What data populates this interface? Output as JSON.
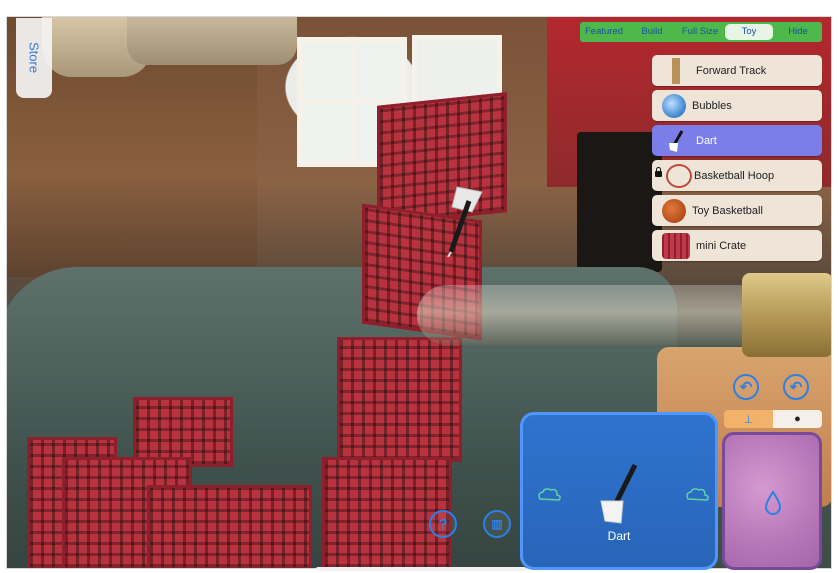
{
  "store": {
    "label": "Store"
  },
  "tabs": [
    {
      "label": "Featured",
      "active": false
    },
    {
      "label": "Build",
      "active": false
    },
    {
      "label": "Full Size",
      "active": false
    },
    {
      "label": "Toy",
      "active": true
    },
    {
      "label": "Hide",
      "active": false
    }
  ],
  "items": [
    {
      "label": "Forward Track",
      "icon": "track-icon",
      "locked": false,
      "selected": false
    },
    {
      "label": "Bubbles",
      "icon": "bubble-icon",
      "locked": false,
      "selected": false
    },
    {
      "label": "Dart",
      "icon": "dart-icon",
      "locked": false,
      "selected": true
    },
    {
      "label": "Basketball Hoop",
      "icon": "hoop-icon",
      "locked": true,
      "selected": false
    },
    {
      "label": "Toy Basketball",
      "icon": "basketball-icon",
      "locked": false,
      "selected": false
    },
    {
      "label": "mini Crate",
      "icon": "crate-icon",
      "locked": false,
      "selected": false
    }
  ],
  "selected_object": {
    "label": "Dart"
  },
  "colors": {
    "accent": "#2e7fe6",
    "tab_bar": "#4eb84a",
    "selected_item": "#7b7ee8",
    "fluid_card": "#b676b8"
  }
}
